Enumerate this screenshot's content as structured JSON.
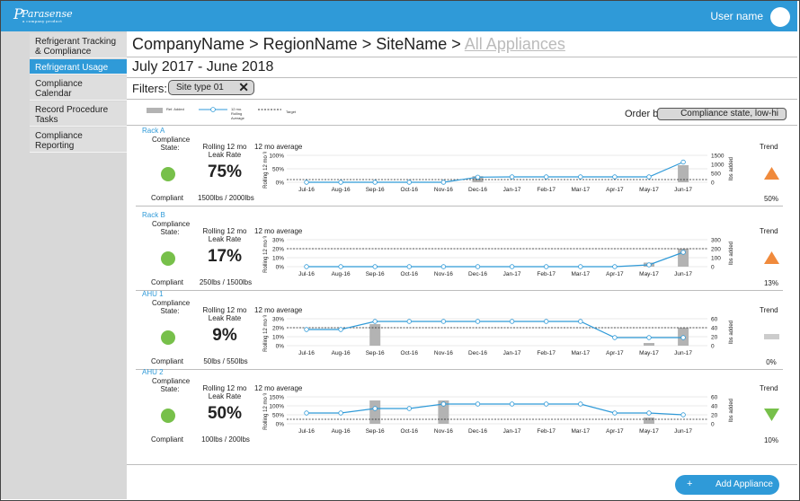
{
  "brand": {
    "logo_text": "Parasense",
    "logo_sub": "a company product"
  },
  "user": {
    "name": "User name"
  },
  "sidebar": {
    "items": [
      {
        "label": "Refrigerant Tracking & Compliance",
        "active": false
      },
      {
        "label": "Refrigerant Usage",
        "active": true
      },
      {
        "label": "Compliance Calendar",
        "active": false
      },
      {
        "label": "Record Procedure Tasks",
        "active": false
      },
      {
        "label": "Compliance Reporting",
        "active": false
      }
    ]
  },
  "breadcrumb": {
    "company": "CompanyName",
    "region": "RegionName",
    "site": "SiteName",
    "separator": ">",
    "link": "All Appliances"
  },
  "period": "July 2017 - June 2018",
  "filters": {
    "label": "Filters:",
    "chip": "Site type 01",
    "remove_icon": "close-icon"
  },
  "legend": {
    "ref_added": "Ref. Added",
    "rolling": "12 mo. Rolling Average",
    "target": "Target"
  },
  "order": {
    "label": "Order by:",
    "value": "Compliance state, low-hi"
  },
  "common_labels": {
    "compliance_state": "Compliance State:",
    "rolling_rate": "Rolling 12 mo Leak Rate",
    "avg": "12 mo average",
    "trend": "Trend",
    "y_left": "Rolling 12 mo %",
    "y_right": "lbs added"
  },
  "months": [
    "Jul-16",
    "Aug-16",
    "Sep-16",
    "Oct-16",
    "Nov-16",
    "Dec-16",
    "Jan-17",
    "Feb-17",
    "Mar-17",
    "Apr-17",
    "May-17",
    "Jun-17"
  ],
  "colors": {
    "accent": "#2f9ad8",
    "compliant": "#77c04a",
    "up": "#f08a3c",
    "down": "#77c04a",
    "flat": "#cccccc",
    "bar": "#b3b3b3"
  },
  "appliances": [
    {
      "name": "Rack A",
      "status": "Compliant",
      "rate": "75%",
      "lbs": "1500lbs / 2000lbs",
      "trend": "up",
      "trend_pct": "50%",
      "chart_data": {
        "type": "line",
        "left_ticks": [
          "100%",
          "50%",
          "0%"
        ],
        "left_max": 100,
        "right_ticks": [
          "1500",
          "1000",
          "500",
          "0"
        ],
        "right_max": 1500,
        "target": 10,
        "line": [
          0,
          0,
          0,
          0,
          0,
          19,
          20,
          20,
          20,
          20,
          20,
          75
        ],
        "bars": [
          0,
          0,
          0,
          0,
          0,
          340,
          0,
          0,
          0,
          0,
          0,
          950
        ]
      }
    },
    {
      "name": "Rack B",
      "status": "Compliant",
      "rate": "17%",
      "lbs": "250lbs / 1500lbs",
      "trend": "up",
      "trend_pct": "13%",
      "chart_data": {
        "type": "line",
        "left_ticks": [
          "30%",
          "20%",
          "10%",
          "0%"
        ],
        "left_max": 30,
        "right_ticks": [
          "300",
          "200",
          "100",
          "0"
        ],
        "right_max": 300,
        "target": 20,
        "line": [
          0,
          0,
          0,
          0,
          0,
          0,
          0,
          0,
          0,
          0,
          2,
          16
        ],
        "bars": [
          0,
          0,
          0,
          0,
          0,
          0,
          0,
          0,
          0,
          0,
          45,
          200
        ]
      }
    },
    {
      "name": "AHU 1",
      "status": "Compliant",
      "rate": "9%",
      "lbs": "50lbs / 550lbs",
      "trend": "flat",
      "trend_pct": "0%",
      "chart_data": {
        "type": "line",
        "left_ticks": [
          "30%",
          "20%",
          "10%",
          "0%"
        ],
        "left_max": 30,
        "right_ticks": [
          "60",
          "40",
          "20",
          "0"
        ],
        "right_max": 60,
        "target": 20,
        "line": [
          18,
          18,
          27,
          27,
          27,
          27,
          27,
          27,
          27,
          9,
          9,
          9
        ],
        "bars": [
          0,
          0,
          48,
          0,
          0,
          0,
          0,
          0,
          0,
          0,
          6,
          40
        ]
      }
    },
    {
      "name": "AHU 2",
      "status": "Compliant",
      "rate": "50%",
      "lbs": "100lbs / 200lbs",
      "trend": "down",
      "trend_pct": "10%",
      "chart_data": {
        "type": "line",
        "left_ticks": [
          "150%",
          "100%",
          "50%",
          "0%"
        ],
        "left_max": 150,
        "right_ticks": [
          "60",
          "40",
          "20",
          "0"
        ],
        "right_max": 60,
        "target": 25,
        "line": [
          60,
          60,
          85,
          85,
          110,
          110,
          110,
          110,
          110,
          60,
          60,
          50
        ],
        "bars": [
          0,
          0,
          52,
          0,
          52,
          0,
          0,
          0,
          0,
          0,
          14,
          0
        ]
      }
    }
  ],
  "add_button": {
    "icon": "plus-icon",
    "label": "Add Appliance"
  }
}
